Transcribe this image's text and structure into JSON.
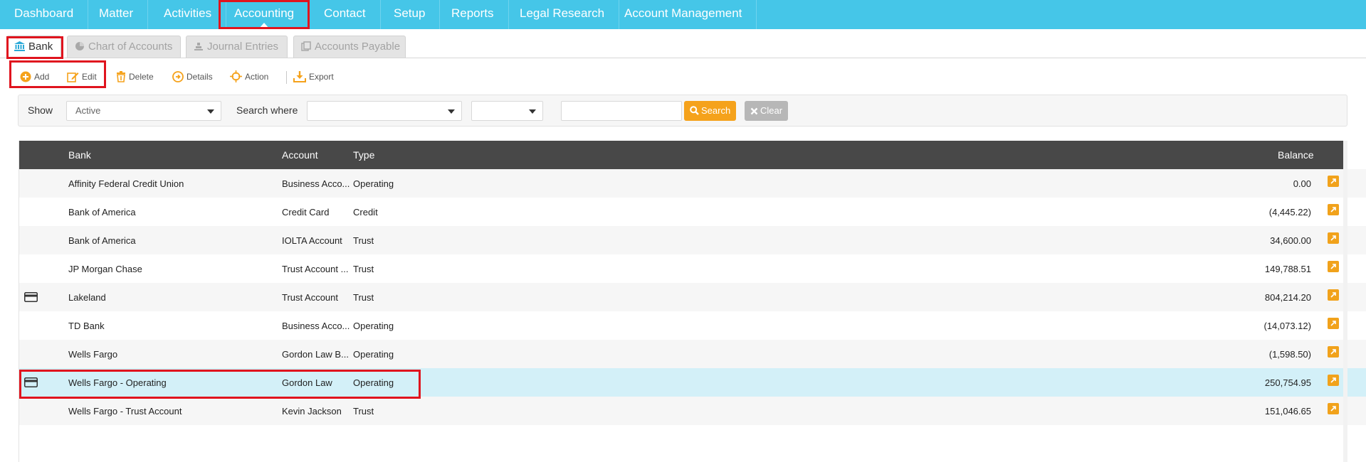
{
  "nav": {
    "items": [
      "Dashboard",
      "Matter",
      "Activities",
      "Accounting",
      "Contact",
      "Setup",
      "Reports",
      "Legal Research",
      "Account Management"
    ],
    "active": "Accounting"
  },
  "tabs": {
    "bank": "Bank",
    "chart_of_accounts": "Chart of Accounts",
    "journal_entries": "Journal Entries",
    "accounts_payable": "Accounts Payable"
  },
  "toolbar": {
    "add": "Add",
    "edit": "Edit",
    "delete": "Delete",
    "details": "Details",
    "action": "Action",
    "export": "Export"
  },
  "filter": {
    "show_label": "Show",
    "show_value": "Active",
    "search_where_label": "Search where",
    "search_where_value": "",
    "operator_value": "",
    "search_text": "",
    "search_button": "Search",
    "clear_button": "Clear"
  },
  "grid": {
    "columns": {
      "bank": "Bank",
      "account": "Account",
      "type": "Type",
      "balance": "Balance"
    },
    "rows": [
      {
        "bank": "Affinity Federal Credit Union",
        "account": "Business Acco...",
        "type": "Operating",
        "balance": "0.00",
        "card": false
      },
      {
        "bank": "Bank of America",
        "account": "Credit Card",
        "type": "Credit",
        "balance": "(4,445.22)",
        "card": false
      },
      {
        "bank": "Bank of America",
        "account": "IOLTA Account",
        "type": "Trust",
        "balance": "34,600.00",
        "card": false
      },
      {
        "bank": "JP Morgan Chase",
        "account": "Trust Account ...",
        "type": "Trust",
        "balance": "149,788.51",
        "card": false
      },
      {
        "bank": "Lakeland",
        "account": "Trust Account",
        "type": "Trust",
        "balance": "804,214.20",
        "card": true
      },
      {
        "bank": "TD Bank",
        "account": "Business Acco...",
        "type": "Operating",
        "balance": "(14,073.12)",
        "card": false
      },
      {
        "bank": "Wells Fargo",
        "account": "Gordon Law B...",
        "type": "Operating",
        "balance": "(1,598.50)",
        "card": false
      },
      {
        "bank": "Wells Fargo - Operating",
        "account": "Gordon Law",
        "type": "Operating",
        "balance": "250,754.95",
        "card": true,
        "selected": true
      },
      {
        "bank": "Wells Fargo - Trust Account",
        "account": "Kevin Jackson",
        "type": "Trust",
        "balance": "151,046.65",
        "card": false
      }
    ]
  },
  "colors": {
    "nav_bg": "#45c6e8",
    "accent_orange": "#f5a21b",
    "header_dark": "#484848",
    "selected_row": "#d3f0f8",
    "highlight_red": "#e0141e"
  },
  "icons": [
    "bank-icon",
    "pie-chart-icon",
    "journal-icon",
    "copy-icon",
    "add-icon",
    "edit-icon",
    "trash-icon",
    "details-icon",
    "action-icon",
    "export-icon",
    "search-icon",
    "clear-icon",
    "credit-card-icon",
    "open-link-icon"
  ]
}
